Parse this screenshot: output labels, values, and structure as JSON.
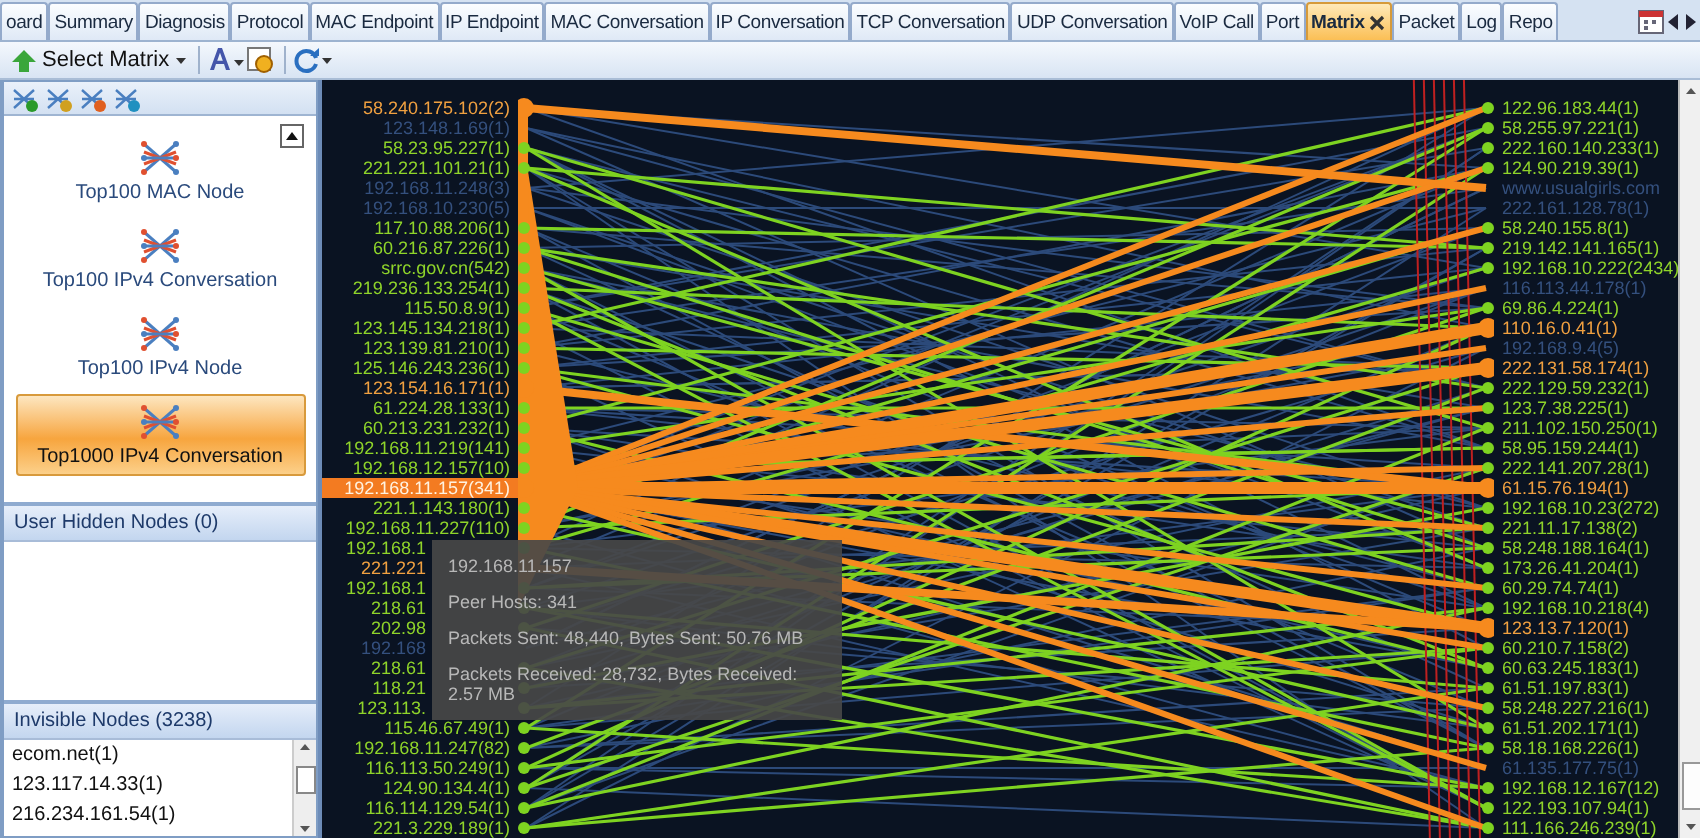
{
  "tabs": [
    {
      "label": "oard",
      "selected": false,
      "closable": false
    },
    {
      "label": "Summary",
      "selected": false,
      "closable": false
    },
    {
      "label": "Diagnosis",
      "selected": false,
      "closable": false
    },
    {
      "label": "Protocol",
      "selected": false,
      "closable": false
    },
    {
      "label": "MAC Endpoint",
      "selected": false,
      "closable": false
    },
    {
      "label": "IP Endpoint",
      "selected": false,
      "closable": false
    },
    {
      "label": "MAC Conversation",
      "selected": false,
      "closable": false
    },
    {
      "label": "IP Conversation",
      "selected": false,
      "closable": false
    },
    {
      "label": "TCP Conversation",
      "selected": false,
      "closable": false
    },
    {
      "label": "UDP Conversation",
      "selected": false,
      "closable": false
    },
    {
      "label": "VoIP Call",
      "selected": false,
      "closable": false
    },
    {
      "label": "Port",
      "selected": false,
      "closable": false
    },
    {
      "label": "Matrix",
      "selected": true,
      "closable": true
    },
    {
      "label": "Packet",
      "selected": false,
      "closable": false
    },
    {
      "label": "Log",
      "selected": false,
      "closable": false
    },
    {
      "label": "Repo",
      "selected": false,
      "closable": false
    }
  ],
  "toolbar": {
    "select_button": "Select Matrix"
  },
  "left_panel": {
    "matrix_types": [
      {
        "label": "Top100 MAC Node",
        "selected": false
      },
      {
        "label": "Top100 IPv4 Conversation",
        "selected": false
      },
      {
        "label": "Top100 IPv4 Node",
        "selected": false
      },
      {
        "label": "Top1000 IPv4 Conversation",
        "selected": true
      }
    ],
    "hidden_nodes": {
      "title": "User Hidden Nodes (0)"
    },
    "invisible_nodes": {
      "title": "Invisible Nodes (3238)",
      "items": [
        "ecom.net(1)",
        "123.117.14.33(1)",
        "216.234.161.54(1)"
      ]
    }
  },
  "matrix": {
    "left_nodes": [
      {
        "label": "58.240.175.102(2)",
        "kind": "highlight",
        "selected": false,
        "covered": false
      },
      {
        "label": "123.148.1.69(1)",
        "kind": "dim",
        "selected": false,
        "covered": false
      },
      {
        "label": "58.23.95.227(1)",
        "kind": "normal",
        "selected": false,
        "covered": false
      },
      {
        "label": "221.221.101.21(1)",
        "kind": "normal",
        "selected": false,
        "covered": false
      },
      {
        "label": "192.168.11.248(3)",
        "kind": "dim",
        "selected": false,
        "covered": false
      },
      {
        "label": "192.168.10.230(5)",
        "kind": "dim",
        "selected": false,
        "covered": false
      },
      {
        "label": "117.10.88.206(1)",
        "kind": "normal",
        "selected": false,
        "covered": false
      },
      {
        "label": "60.216.87.226(1)",
        "kind": "normal",
        "selected": false,
        "covered": false
      },
      {
        "label": "srrc.gov.cn(542)",
        "kind": "normal",
        "selected": false,
        "covered": false
      },
      {
        "label": "219.236.133.254(1)",
        "kind": "normal",
        "selected": false,
        "covered": false
      },
      {
        "label": "115.50.8.9(1)",
        "kind": "normal",
        "selected": false,
        "covered": false
      },
      {
        "label": "123.145.134.218(1)",
        "kind": "normal",
        "selected": false,
        "covered": false
      },
      {
        "label": "123.139.81.210(1)",
        "kind": "normal",
        "selected": false,
        "covered": false
      },
      {
        "label": "125.146.243.236(1)",
        "kind": "normal",
        "selected": false,
        "covered": false
      },
      {
        "label": "123.154.16.171(1)",
        "kind": "highlight",
        "selected": false,
        "covered": false
      },
      {
        "label": "61.224.28.133(1)",
        "kind": "normal",
        "selected": false,
        "covered": false
      },
      {
        "label": "60.213.231.232(1)",
        "kind": "normal",
        "selected": false,
        "covered": false
      },
      {
        "label": "192.168.11.219(141)",
        "kind": "normal",
        "selected": false,
        "covered": false
      },
      {
        "label": "192.168.12.157(10)",
        "kind": "normal",
        "selected": false,
        "covered": false
      },
      {
        "label": "192.168.11.157(341)",
        "kind": "highlight",
        "selected": true,
        "covered": false
      },
      {
        "label": "221.1.143.180(1)",
        "kind": "normal",
        "selected": false,
        "covered": false
      },
      {
        "label": "192.168.11.227(110)",
        "kind": "normal",
        "selected": false,
        "covered": false
      },
      {
        "label": "192.168.1",
        "kind": "normal",
        "selected": false,
        "covered": true
      },
      {
        "label": "221.221",
        "kind": "highlight",
        "selected": false,
        "covered": true
      },
      {
        "label": "192.168.1",
        "kind": "normal",
        "selected": false,
        "covered": true
      },
      {
        "label": "218.61",
        "kind": "normal",
        "selected": false,
        "covered": true
      },
      {
        "label": "202.98",
        "kind": "normal",
        "selected": false,
        "covered": true
      },
      {
        "label": "192.168",
        "kind": "dim",
        "selected": false,
        "covered": true
      },
      {
        "label": "218.61",
        "kind": "normal",
        "selected": false,
        "covered": true
      },
      {
        "label": "118.21",
        "kind": "normal",
        "selected": false,
        "covered": true
      },
      {
        "label": "123.113.",
        "kind": "normal",
        "selected": false,
        "covered": true
      },
      {
        "label": "115.46.67.49(1)",
        "kind": "normal",
        "selected": false,
        "covered": false
      },
      {
        "label": "192.168.11.247(82)",
        "kind": "normal",
        "selected": false,
        "covered": false
      },
      {
        "label": "116.113.50.249(1)",
        "kind": "normal",
        "selected": false,
        "covered": false
      },
      {
        "label": "124.90.134.4(1)",
        "kind": "normal",
        "selected": false,
        "covered": false
      },
      {
        "label": "116.114.129.54(1)",
        "kind": "normal",
        "selected": false,
        "covered": false
      },
      {
        "label": "221.3.229.189(1)",
        "kind": "normal",
        "selected": false,
        "covered": false
      }
    ],
    "right_nodes": [
      {
        "label": "122.96.183.44(1)",
        "kind": "normal",
        "selected": false
      },
      {
        "label": "58.255.97.221(1)",
        "kind": "normal",
        "selected": false
      },
      {
        "label": "222.160.140.233(1)",
        "kind": "normal",
        "selected": false
      },
      {
        "label": "124.90.219.39(1)",
        "kind": "normal",
        "selected": false
      },
      {
        "label": "www.usualgirls.com",
        "kind": "dim",
        "selected": false
      },
      {
        "label": "222.161.128.78(1)",
        "kind": "dim",
        "selected": false
      },
      {
        "label": "58.240.155.8(1)",
        "kind": "normal",
        "selected": false
      },
      {
        "label": "219.142.141.165(1)",
        "kind": "normal",
        "selected": false
      },
      {
        "label": "192.168.10.222(2434)",
        "kind": "normal",
        "selected": false
      },
      {
        "label": "116.113.44.178(1)",
        "kind": "dim",
        "selected": false
      },
      {
        "label": "69.86.4.224(1)",
        "kind": "normal",
        "selected": false
      },
      {
        "label": "110.16.0.41(1)",
        "kind": "highlight",
        "selected": false
      },
      {
        "label": "192.168.9.4(5)",
        "kind": "dim",
        "selected": false
      },
      {
        "label": "222.131.58.174(1)",
        "kind": "highlight",
        "selected": false
      },
      {
        "label": "222.129.59.232(1)",
        "kind": "normal",
        "selected": false
      },
      {
        "label": "123.7.38.225(1)",
        "kind": "normal",
        "selected": false
      },
      {
        "label": "211.102.150.250(1)",
        "kind": "normal",
        "selected": false
      },
      {
        "label": "58.95.159.244(1)",
        "kind": "normal",
        "selected": false
      },
      {
        "label": "222.141.207.28(1)",
        "kind": "normal",
        "selected": false
      },
      {
        "label": "61.15.76.194(1)",
        "kind": "highlight",
        "selected": false
      },
      {
        "label": "192.168.10.23(272)",
        "kind": "normal",
        "selected": false
      },
      {
        "label": "221.11.17.138(2)",
        "kind": "normal",
        "selected": false
      },
      {
        "label": "58.248.188.164(1)",
        "kind": "normal",
        "selected": false
      },
      {
        "label": "173.26.41.204(1)",
        "kind": "normal",
        "selected": false
      },
      {
        "label": "60.29.74.74(1)",
        "kind": "normal",
        "selected": false
      },
      {
        "label": "192.168.10.218(4)",
        "kind": "normal",
        "selected": false
      },
      {
        "label": "123.13.7.120(1)",
        "kind": "highlight",
        "selected": false
      },
      {
        "label": "60.210.7.158(2)",
        "kind": "normal",
        "selected": false
      },
      {
        "label": "60.63.245.183(1)",
        "kind": "normal",
        "selected": false
      },
      {
        "label": "61.51.197.83(1)",
        "kind": "normal",
        "selected": false
      },
      {
        "label": "58.248.227.216(1)",
        "kind": "normal",
        "selected": false
      },
      {
        "label": "61.51.202.171(1)",
        "kind": "normal",
        "selected": false
      },
      {
        "label": "58.18.168.226(1)",
        "kind": "normal",
        "selected": false
      },
      {
        "label": "61.135.177.75(1)",
        "kind": "dim",
        "selected": false
      },
      {
        "label": "192.168.12.167(12)",
        "kind": "normal",
        "selected": false
      },
      {
        "label": "122.193.107.94(1)",
        "kind": "normal",
        "selected": false
      },
      {
        "label": "111.166.246.239(1)",
        "kind": "normal",
        "selected": false
      }
    ],
    "tooltip": {
      "title": "192.168.11.157",
      "lines": [
        "Peer Hosts: 341",
        "Packets Sent: 48,440, Bytes Sent: 50.76 MB",
        "Packets Received: 28,732, Bytes Received: 2.57 MB"
      ]
    }
  }
}
